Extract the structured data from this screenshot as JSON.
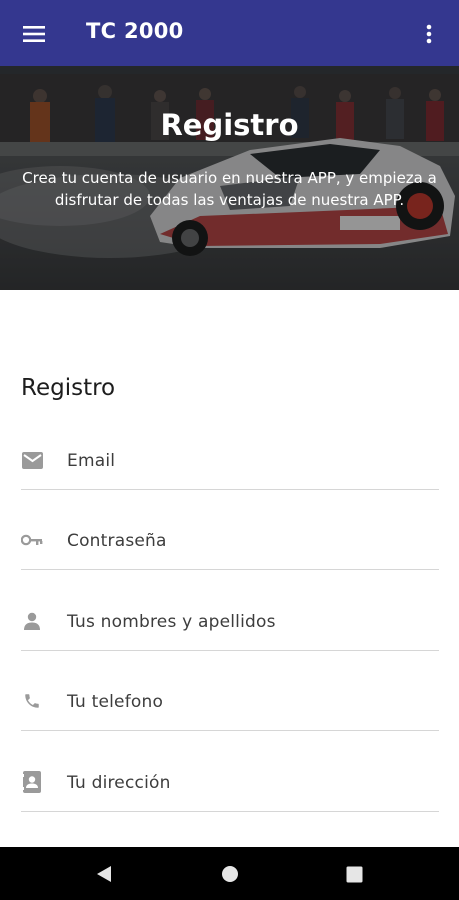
{
  "app_bar": {
    "title": "TC 2000",
    "menu_icon": "hamburger-menu-icon",
    "overflow_icon": "more-vertical-icon",
    "color": "#34378f"
  },
  "hero": {
    "title": "Registro",
    "subtitle": "Crea tu cuenta de usuario en nuestra APP, y empieza a disfrutar de todas las ventajas de nuestra APP."
  },
  "form": {
    "title": "Registro",
    "fields": [
      {
        "label": "Email",
        "icon": "mail-icon"
      },
      {
        "label": "Contraseña",
        "icon": "key-icon"
      },
      {
        "label": "Tus nombres y apellidos",
        "icon": "person-icon"
      },
      {
        "label": "Tu telefono",
        "icon": "phone-icon"
      },
      {
        "label": "Tu dirección",
        "icon": "contact-card-icon"
      }
    ]
  },
  "nav_bar": {
    "back_icon": "back-triangle-icon",
    "home_icon": "home-circle-icon",
    "recents_icon": "recents-square-icon"
  }
}
